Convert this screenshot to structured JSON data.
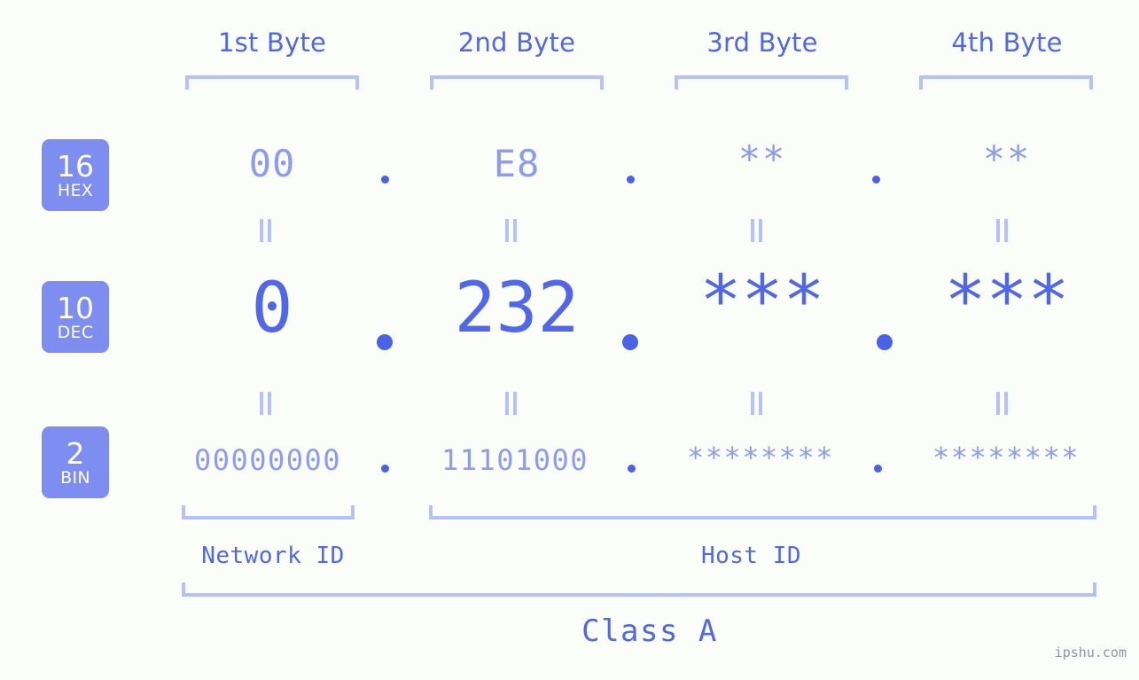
{
  "meta": {
    "watermark": "ipshu.com",
    "background_color": "#fbfdf8",
    "accent_color": "#5068e8",
    "accent_light_color": "#8b9cf2",
    "bracket_color": "#b4c1fa",
    "badge_color": "#7d8ef0"
  },
  "headers": {
    "byte1": "1st Byte",
    "byte2": "2nd Byte",
    "byte3": "3rd Byte",
    "byte4": "4th Byte"
  },
  "bases": [
    {
      "number": "16",
      "name": "HEX"
    },
    {
      "number": "10",
      "name": "DEC"
    },
    {
      "number": "2",
      "name": "BIN"
    }
  ],
  "rows": {
    "hex": {
      "base_number": "16",
      "base_name": "HEX",
      "values": [
        "00",
        "E8",
        "**",
        "**"
      ],
      "separator": "."
    },
    "dec": {
      "base_number": "10",
      "base_name": "DEC",
      "values": [
        "0",
        "232",
        "***",
        "***"
      ],
      "separator": "."
    },
    "bin": {
      "base_number": "2",
      "base_name": "BIN",
      "values": [
        "00000000",
        "11101000",
        "********",
        "********"
      ],
      "separator": "."
    }
  },
  "connectors": {
    "symbol": "‖",
    "meaning": "equals"
  },
  "sections": {
    "network_id": "Network ID",
    "host_id": "Host ID",
    "class": "Class A"
  }
}
